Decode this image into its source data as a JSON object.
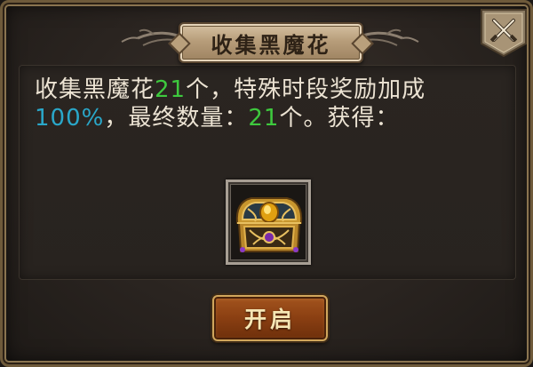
{
  "dialog": {
    "title": "收集黑魔花",
    "close_icon": "crossed-swords-close-icon"
  },
  "message": {
    "part1": "收集黑魔花",
    "collected_count": "21",
    "part2": "个，特殊时段奖励加成",
    "bonus_percent": "100%",
    "part3": "，最终数量：",
    "final_count": "21",
    "part4": "个。获得："
  },
  "reward": {
    "icon": "treasure-chest-icon"
  },
  "open_button": {
    "label": "开启"
  },
  "colors": {
    "count_green": "#3ec93e",
    "percent_blue": "#2aa7c9",
    "frame_gold": "#8a7450",
    "button_brown": "#8a3f12"
  }
}
